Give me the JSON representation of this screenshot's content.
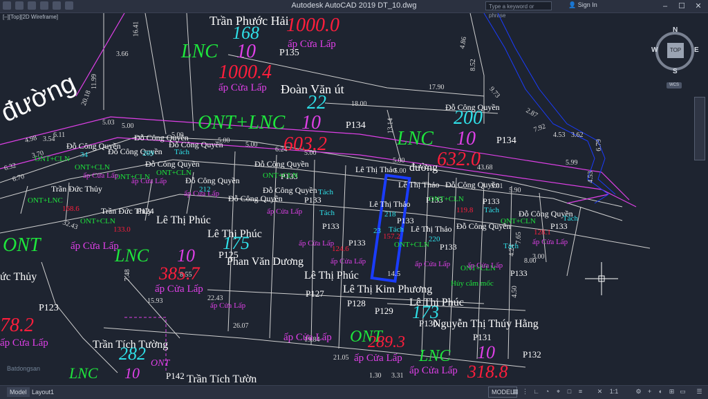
{
  "window": {
    "title": "Autodesk AutoCAD 2019     DT_10.dwg",
    "search_placeholder": "Type a keyword or phrase",
    "signin": "Sign In",
    "minimize": "–",
    "maximize": "☐",
    "close": "✕"
  },
  "viewport": {
    "label": "[–][Top][2D Wireframe]"
  },
  "viewcube": {
    "north": "N",
    "south": "S",
    "east": "E",
    "west": "W",
    "face": "TOP",
    "wcs": "WCS"
  },
  "layout_tabs": {
    "model": "Model",
    "layout1": "Layout1"
  },
  "status": {
    "model_button": "MODEL",
    "scale": "1:1"
  },
  "watermark": "Batdongsan",
  "colors": {
    "background": "#1e2430",
    "parcel_lines": "#c8c8c8",
    "magenta": "#e040e8",
    "green": "#1ee63c",
    "cyan": "#2fe0e8",
    "red": "#ff1e3c",
    "white": "#ffffff",
    "blue_highlight": "#1a3cff"
  },
  "labels": [
    {
      "text": "Trần Phước Hải",
      "color": "#ffffff",
      "size": 18
    },
    {
      "text": "168",
      "color": "#2fe0e8",
      "size": 26
    },
    {
      "text": "1000.0",
      "color": "#ff1e3c",
      "size": 28
    },
    {
      "text": "ấp Cửa Lấp",
      "color": "#e040e8",
      "size": 15
    },
    {
      "text": "LNC",
      "color": "#1ee63c",
      "size": 28
    },
    {
      "text": "10",
      "color": "#e040e8",
      "size": 28
    },
    {
      "text": "P135",
      "color": "#ffffff",
      "size": 14
    },
    {
      "text": "1000.4",
      "color": "#ff1e3c",
      "size": 28
    },
    {
      "text": "ấp Cửa Lấp",
      "color": "#e040e8",
      "size": 15
    },
    {
      "text": "Đoàn Văn út",
      "color": "#ffffff",
      "size": 18
    },
    {
      "text": "22",
      "color": "#2fe0e8",
      "size": 28
    },
    {
      "text": "ONT+LNC",
      "color": "#1ee63c",
      "size": 28
    },
    {
      "text": "10",
      "color": "#e040e8",
      "size": 28
    },
    {
      "text": "P134",
      "color": "#ffffff",
      "size": 14
    },
    {
      "text": "603.2",
      "color": "#ff1e3c",
      "size": 28
    },
    {
      "text": "Đỗ Công Quyền",
      "color": "#ffffff",
      "size": 12
    },
    {
      "text": "200",
      "color": "#2fe0e8",
      "size": 28
    },
    {
      "text": "LNC",
      "color": "#1ee63c",
      "size": 28
    },
    {
      "text": "10",
      "color": "#e040e8",
      "size": 28
    },
    {
      "text": "P134",
      "color": "#ffffff",
      "size": 14
    },
    {
      "text": "632.0",
      "color": "#ff1e3c",
      "size": 28
    },
    {
      "text": "đường",
      "color": "#ffffff",
      "size": 16
    },
    {
      "text": "đường",
      "color": "#ffffff",
      "size": 38
    },
    {
      "text": "Lê Thị Phúc",
      "color": "#ffffff",
      "size": 16
    },
    {
      "text": "Lê Thị Phúc",
      "color": "#ffffff",
      "size": 16
    },
    {
      "text": "175",
      "color": "#2fe0e8",
      "size": 26
    },
    {
      "text": "LNC",
      "color": "#1ee63c",
      "size": 26
    },
    {
      "text": "10",
      "color": "#e040e8",
      "size": 26
    },
    {
      "text": "P125",
      "color": "#ffffff",
      "size": 14
    },
    {
      "text": "ấp Cửa Lấp",
      "color": "#e040e8",
      "size": 15
    },
    {
      "text": "385.7",
      "color": "#ff1e3c",
      "size": 26
    },
    {
      "text": "ấp Cửa Lấp",
      "color": "#e040e8",
      "size": 15
    },
    {
      "text": "ONT",
      "color": "#1ee63c",
      "size": 28
    },
    {
      "text": "ức Thủy",
      "color": "#ffffff",
      "size": 16
    },
    {
      "text": "P123",
      "color": "#ffffff",
      "size": 14
    },
    {
      "text": "78.2",
      "color": "#ff1e3c",
      "size": 28
    },
    {
      "text": "ấp Cửa Lấp",
      "color": "#e040e8",
      "size": 15
    },
    {
      "text": "Phan Văn Dương",
      "color": "#ffffff",
      "size": 16
    },
    {
      "text": "Lê Thị Phúc",
      "color": "#ffffff",
      "size": 16
    },
    {
      "text": "Lê Thị Kim Phương",
      "color": "#ffffff",
      "size": 16
    },
    {
      "text": "Lê Thị Phúc",
      "color": "#ffffff",
      "size": 16
    },
    {
      "text": "173",
      "color": "#2fe0e8",
      "size": 26
    },
    {
      "text": "P128",
      "color": "#ffffff",
      "size": 13
    },
    {
      "text": "P127",
      "color": "#ffffff",
      "size": 13
    },
    {
      "text": "P129",
      "color": "#ffffff",
      "size": 13
    },
    {
      "text": "P130",
      "color": "#ffffff",
      "size": 13
    },
    {
      "text": "Nguyễn Thị Thúy Hằng",
      "color": "#ffffff",
      "size": 16
    },
    {
      "text": "P131",
      "color": "#ffffff",
      "size": 13
    },
    {
      "text": "ONT",
      "color": "#1ee63c",
      "size": 24
    },
    {
      "text": "289.3",
      "color": "#ff1e3c",
      "size": 24
    },
    {
      "text": "10",
      "color": "#e040e8",
      "size": 26
    },
    {
      "text": "P132",
      "color": "#ffffff",
      "size": 13
    },
    {
      "text": "LNC",
      "color": "#1ee63c",
      "size": 24
    },
    {
      "text": "318.8",
      "color": "#ff1e3c",
      "size": 26
    },
    {
      "text": "ấp Cửa Lấp",
      "color": "#e040e8",
      "size": 15
    },
    {
      "text": "ấp Cửa Lấp",
      "color": "#e040e8",
      "size": 15
    },
    {
      "text": "ấp Cửa Lấp",
      "color": "#e040e8",
      "size": 15
    },
    {
      "text": "Trần Tích Tường",
      "color": "#ffffff",
      "size": 16
    },
    {
      "text": "282",
      "color": "#2fe0e8",
      "size": 26
    },
    {
      "text": "ONT",
      "color": "#e040e8",
      "size": 14
    },
    {
      "text": "LNC",
      "color": "#1ee63c",
      "size": 22
    },
    {
      "text": "10",
      "color": "#e040e8",
      "size": 22
    },
    {
      "text": "P142",
      "color": "#ffffff",
      "size": 13
    },
    {
      "text": "Trần Tích Tườn",
      "color": "#ffffff",
      "size": 16
    },
    {
      "text": "Đỗ Công Quyền",
      "color": "#ffffff",
      "size": 12
    },
    {
      "text": "Đỗ Công Quyền",
      "color": "#ffffff",
      "size": 12
    },
    {
      "text": "Đỗ Công Quyền",
      "color": "#ffffff",
      "size": 12
    },
    {
      "text": "Đỗ Công Quyền",
      "color": "#ffffff",
      "size": 12
    },
    {
      "text": "Đỗ Công Quyền",
      "color": "#ffffff",
      "size": 12
    },
    {
      "text": "Đỗ Công Quyền",
      "color": "#ffffff",
      "size": 12
    },
    {
      "text": "Đỗ Công Quyền",
      "color": "#ffffff",
      "size": 12
    },
    {
      "text": "Đỗ Công Quyền",
      "color": "#ffffff",
      "size": 12
    },
    {
      "text": "Đỗ Công Quyền",
      "color": "#ffffff",
      "size": 12
    },
    {
      "text": "Đỗ Công Quyền",
      "color": "#ffffff",
      "size": 12
    },
    {
      "text": "Đỗ Công Quyền",
      "color": "#ffffff",
      "size": 12
    },
    {
      "text": "Đỗ Công Quyền",
      "color": "#ffffff",
      "size": 12
    },
    {
      "text": "Lê Thị Thảo",
      "color": "#ffffff",
      "size": 12
    },
    {
      "text": "Lê Thị Thảo",
      "color": "#ffffff",
      "size": 12
    },
    {
      "text": "Lê Thị Thảo",
      "color": "#ffffff",
      "size": 12
    },
    {
      "text": "Lê Thị Thảo",
      "color": "#ffffff",
      "size": 12
    },
    {
      "text": "Trần Đức Thủy",
      "color": "#ffffff",
      "size": 12
    },
    {
      "text": "Trần Đức Thủy",
      "color": "#ffffff",
      "size": 12
    },
    {
      "text": "P124",
      "color": "#ffffff",
      "size": 12
    },
    {
      "text": "P133",
      "color": "#ffffff",
      "size": 12
    },
    {
      "text": "P133",
      "color": "#ffffff",
      "size": 12
    },
    {
      "text": "P133",
      "color": "#ffffff",
      "size": 12
    },
    {
      "text": "P133",
      "color": "#ffffff",
      "size": 12
    },
    {
      "text": "P133",
      "color": "#ffffff",
      "size": 12
    },
    {
      "text": "P133",
      "color": "#ffffff",
      "size": 12
    },
    {
      "text": "P133",
      "color": "#ffffff",
      "size": 12
    },
    {
      "text": "P133",
      "color": "#ffffff",
      "size": 12
    },
    {
      "text": "P133",
      "color": "#ffffff",
      "size": 12
    },
    {
      "text": "P133",
      "color": "#ffffff",
      "size": 12
    },
    {
      "text": "ONT+CLN",
      "color": "#1ee63c",
      "size": 11
    },
    {
      "text": "ONT+CLN",
      "color": "#1ee63c",
      "size": 11
    },
    {
      "text": "ONT+CLN",
      "color": "#1ee63c",
      "size": 11
    },
    {
      "text": "ONT+CLN",
      "color": "#1ee63c",
      "size": 11
    },
    {
      "text": "ONT+CLN",
      "color": "#1ee63c",
      "size": 11
    },
    {
      "text": "ONT+CLN",
      "color": "#1ee63c",
      "size": 11
    },
    {
      "text": "ONT+CLN",
      "color": "#1ee63c",
      "size": 11
    },
    {
      "text": "ONT+CLN",
      "color": "#1ee63c",
      "size": 11
    },
    {
      "text": "ONT+CLN",
      "color": "#1ee63c",
      "size": 11
    },
    {
      "text": "ONT+LNC",
      "color": "#1ee63c",
      "size": 11
    },
    {
      "text": "ONT+CLN",
      "color": "#1ee63c",
      "size": 11
    },
    {
      "text": "Tách",
      "color": "#2fe0e8",
      "size": 11
    },
    {
      "text": "Tách",
      "color": "#2fe0e8",
      "size": 11
    },
    {
      "text": "Tách",
      "color": "#2fe0e8",
      "size": 11
    },
    {
      "text": "Tách",
      "color": "#2fe0e8",
      "size": 11
    },
    {
      "text": "Tách",
      "color": "#2fe0e8",
      "size": 11
    },
    {
      "text": "Tách",
      "color": "#2fe0e8",
      "size": 11
    },
    {
      "text": "Tách",
      "color": "#2fe0e8",
      "size": 11
    },
    {
      "text": "Hủy cắm mốc",
      "color": "#1ee63c",
      "size": 11
    },
    {
      "text": "ấp Cửa Lấp",
      "color": "#e040e8",
      "size": 11
    },
    {
      "text": "ấp Cửa Lấp",
      "color": "#e040e8",
      "size": 11
    },
    {
      "text": "ấp Cửa Lấp",
      "color": "#e040e8",
      "size": 11
    },
    {
      "text": "ấp Cửa Lấp",
      "color": "#e040e8",
      "size": 11
    },
    {
      "text": "ấp Cửa Lấp",
      "color": "#e040e8",
      "size": 11
    },
    {
      "text": "ấp Cửa Lấp",
      "color": "#e040e8",
      "size": 11
    },
    {
      "text": "ấp Cửa Lấp",
      "color": "#e040e8",
      "size": 11
    },
    {
      "text": "ấp Cửa Lấp",
      "color": "#e040e8",
      "size": 11
    },
    {
      "text": "ấp Cửa Lấp",
      "color": "#e040e8",
      "size": 11
    },
    {
      "text": "ấp Cửa Lấp",
      "color": "#e040e8",
      "size": 11
    },
    {
      "text": "34",
      "color": "#2fe0e8",
      "size": 11
    },
    {
      "text": "209",
      "color": "#2fe0e8",
      "size": 11
    },
    {
      "text": "212",
      "color": "#2fe0e8",
      "size": 11
    },
    {
      "text": "220",
      "color": "#2fe0e8",
      "size": 11
    },
    {
      "text": "218",
      "color": "#2fe0e8",
      "size": 11
    },
    {
      "text": "23",
      "color": "#2fe0e8",
      "size": 11
    },
    {
      "text": "133.0",
      "color": "#ff1e3c",
      "size": 11
    },
    {
      "text": "168.6",
      "color": "#ff1e3c",
      "size": 11
    },
    {
      "text": "119.8",
      "color": "#ff1e3c",
      "size": 11
    },
    {
      "text": "128.1",
      "color": "#ff1e3c",
      "size": 11
    },
    {
      "text": "157.2",
      "color": "#ff1e3c",
      "size": 11
    },
    {
      "text": "124.6",
      "color": "#ff1e3c",
      "size": 11
    }
  ],
  "dimensions": [
    "16.41",
    "3.66",
    "11.99",
    "20.18",
    "8.52",
    "4.86",
    "17.90",
    "18.00",
    "13.14",
    "9.73",
    "2.87",
    "7.92",
    "4.53",
    "3.62",
    "6.79",
    "5.99",
    "4.53",
    "6.11",
    "5.03",
    "5.00",
    "4.98",
    "3.54",
    "6.32",
    "6.70",
    "3.70",
    "5.00",
    "5.00",
    "5.00",
    "6.24",
    "5.00",
    "5.00",
    "43.68",
    "5.01",
    "5.90",
    "32.43",
    "8.55",
    "7.48",
    "15.93",
    "26.07",
    "21.05",
    "19.84",
    "22.43",
    "3.31",
    "4.24",
    "7.65",
    "3.00",
    "8.00",
    "14.5",
    "5.00",
    "4.50",
    "1.30"
  ]
}
